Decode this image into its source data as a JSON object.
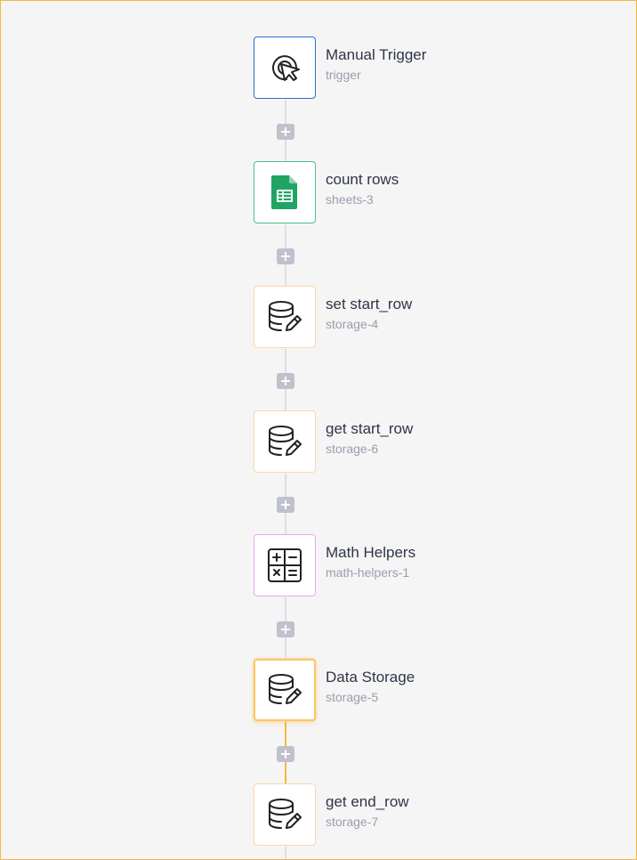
{
  "workflow": {
    "nodes": [
      {
        "title": "Manual Trigger",
        "subtitle": "trigger",
        "kind": "trigger",
        "icon": "cursor-click-icon",
        "border_color": "#2b6cd6"
      },
      {
        "title": "count rows",
        "subtitle": "sheets-3",
        "kind": "sheets",
        "icon": "google-sheets-icon",
        "border_color": "#4cc08a"
      },
      {
        "title": "set start_row",
        "subtitle": "storage-4",
        "kind": "storage",
        "icon": "database-edit-icon",
        "border_color": "#f9d8a6"
      },
      {
        "title": "get start_row",
        "subtitle": "storage-6",
        "kind": "storage",
        "icon": "database-edit-icon",
        "border_color": "#f9d8a6"
      },
      {
        "title": "Math Helpers",
        "subtitle": "math-helpers-1",
        "kind": "math",
        "icon": "calculator-icon",
        "border_color": "#e9a7ea"
      },
      {
        "title": "Data Storage",
        "subtitle": "storage-5",
        "kind": "storage",
        "icon": "database-edit-icon",
        "border_color": "#f9c56a",
        "selected": true
      },
      {
        "title": "get end_row",
        "subtitle": "storage-7",
        "kind": "storage",
        "icon": "database-edit-icon",
        "border_color": "#f9d8a6"
      }
    ],
    "colors": {
      "canvas_border": "#f6b741",
      "connector": "#dedee3",
      "active_connector": "#f6b741",
      "add_button": "#bfc1cc"
    }
  }
}
